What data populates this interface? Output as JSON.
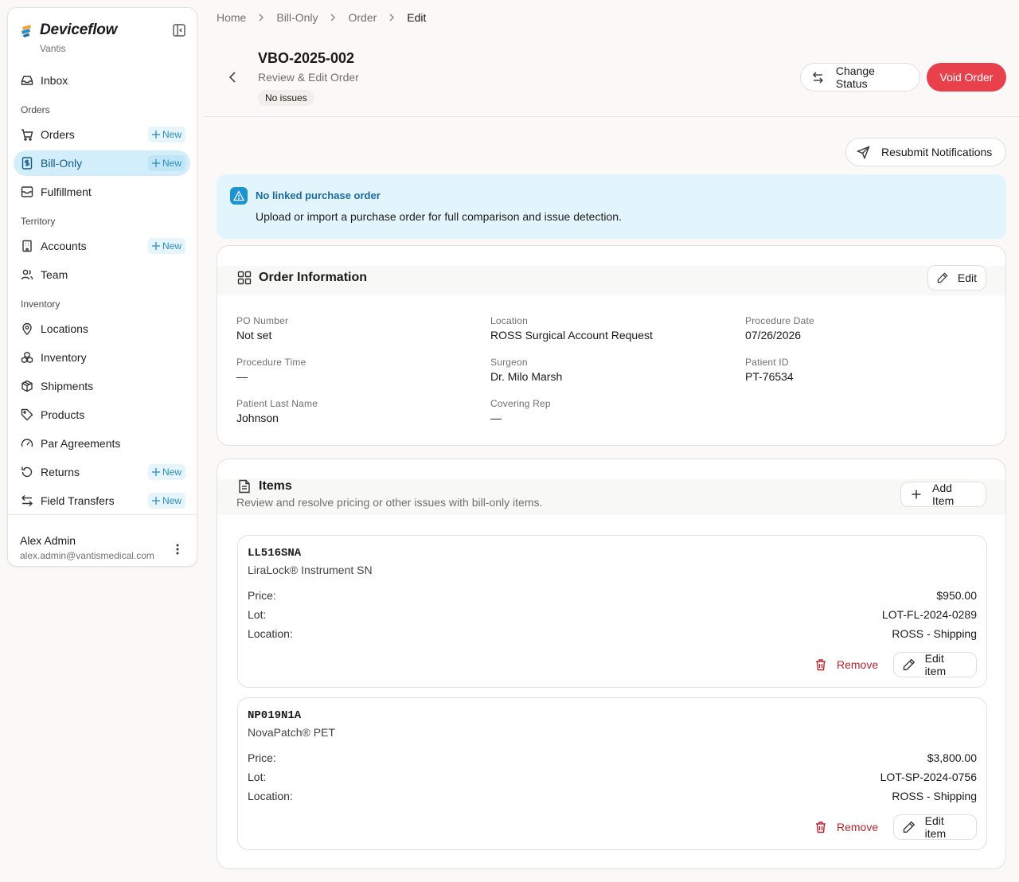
{
  "app": {
    "name": "Deviceflow",
    "tenant": "Vantis"
  },
  "sidebar": {
    "items": [
      {
        "label": "Inbox",
        "icon": "inbox-icon"
      },
      {
        "label": "Orders",
        "icon": "cart-icon",
        "new": "New"
      },
      {
        "label": "Bill-Only",
        "icon": "dollar-doc-icon",
        "new": "New",
        "active": true
      },
      {
        "label": "Fulfillment",
        "icon": "fulfillment-icon"
      },
      {
        "label": "Accounts",
        "icon": "building-icon",
        "new": "New"
      },
      {
        "label": "Team",
        "icon": "users-icon"
      },
      {
        "label": "Locations",
        "icon": "map-pin-icon"
      },
      {
        "label": "Inventory",
        "icon": "boxes-icon"
      },
      {
        "label": "Shipments",
        "icon": "package-icon"
      },
      {
        "label": "Products",
        "icon": "tag-icon"
      },
      {
        "label": "Par Agreements",
        "icon": "gauge-icon"
      },
      {
        "label": "Returns",
        "icon": "rotate-ccw-icon",
        "new": "New"
      },
      {
        "label": "Field Transfers",
        "icon": "arrows-exchange-icon",
        "new": "New"
      }
    ],
    "sections": {
      "orders": "Orders",
      "territory": "Territory",
      "inventory": "Inventory"
    },
    "user": {
      "name": "Alex Admin",
      "email": "alex.admin@vantismedical.com"
    }
  },
  "breadcrumb": [
    "Home",
    "Bill-Only",
    "Order",
    "Edit"
  ],
  "header": {
    "order_id": "VBO-2025-002",
    "subtitle": "Review & Edit Order",
    "badge": "No issues",
    "change_status": "Change Status",
    "void_order": "Void Order"
  },
  "actions": {
    "resubmit": "Resubmit Notifications"
  },
  "alert": {
    "title": "No linked purchase order",
    "text": "Upload or import a purchase order for full comparison and issue detection."
  },
  "order_info": {
    "title": "Order Information",
    "edit": "Edit",
    "fields": [
      {
        "label": "PO Number",
        "value": "Not set"
      },
      {
        "label": "Location",
        "value": "ROSS Surgical Account Request"
      },
      {
        "label": "Procedure Date",
        "value": "07/26/2026"
      },
      {
        "label": "Procedure Time",
        "value": "—"
      },
      {
        "label": "Surgeon",
        "value": "Dr. Milo Marsh"
      },
      {
        "label": "Patient ID",
        "value": "PT-76534"
      },
      {
        "label": "Patient Last Name",
        "value": "Johnson"
      },
      {
        "label": "Covering Rep",
        "value": "—"
      }
    ]
  },
  "items_section": {
    "title": "Items",
    "subtitle": "Review and resolve pricing or other issues with bill-only items.",
    "add_item": "Add Item",
    "labels": {
      "price": "Price:",
      "lot": "Lot:",
      "location": "Location:"
    },
    "remove": "Remove",
    "edit_item": "Edit item",
    "items": [
      {
        "sku": "LL516SNA",
        "name": "LiraLock® Instrument SN",
        "price": "$950.00",
        "lot": "LOT-FL-2024-0289",
        "location": "ROSS - Shipping"
      },
      {
        "sku": "NP019N1A",
        "name": "NovaPatch® PET",
        "price": "$3,800.00",
        "lot": "LOT-SP-2024-0756",
        "location": "ROSS - Shipping"
      }
    ]
  },
  "colors": {
    "accent": "#1b95d2",
    "active_bg": "#d2eefb",
    "danger": "#e8414c",
    "new_badge": "#2a8fc2"
  }
}
